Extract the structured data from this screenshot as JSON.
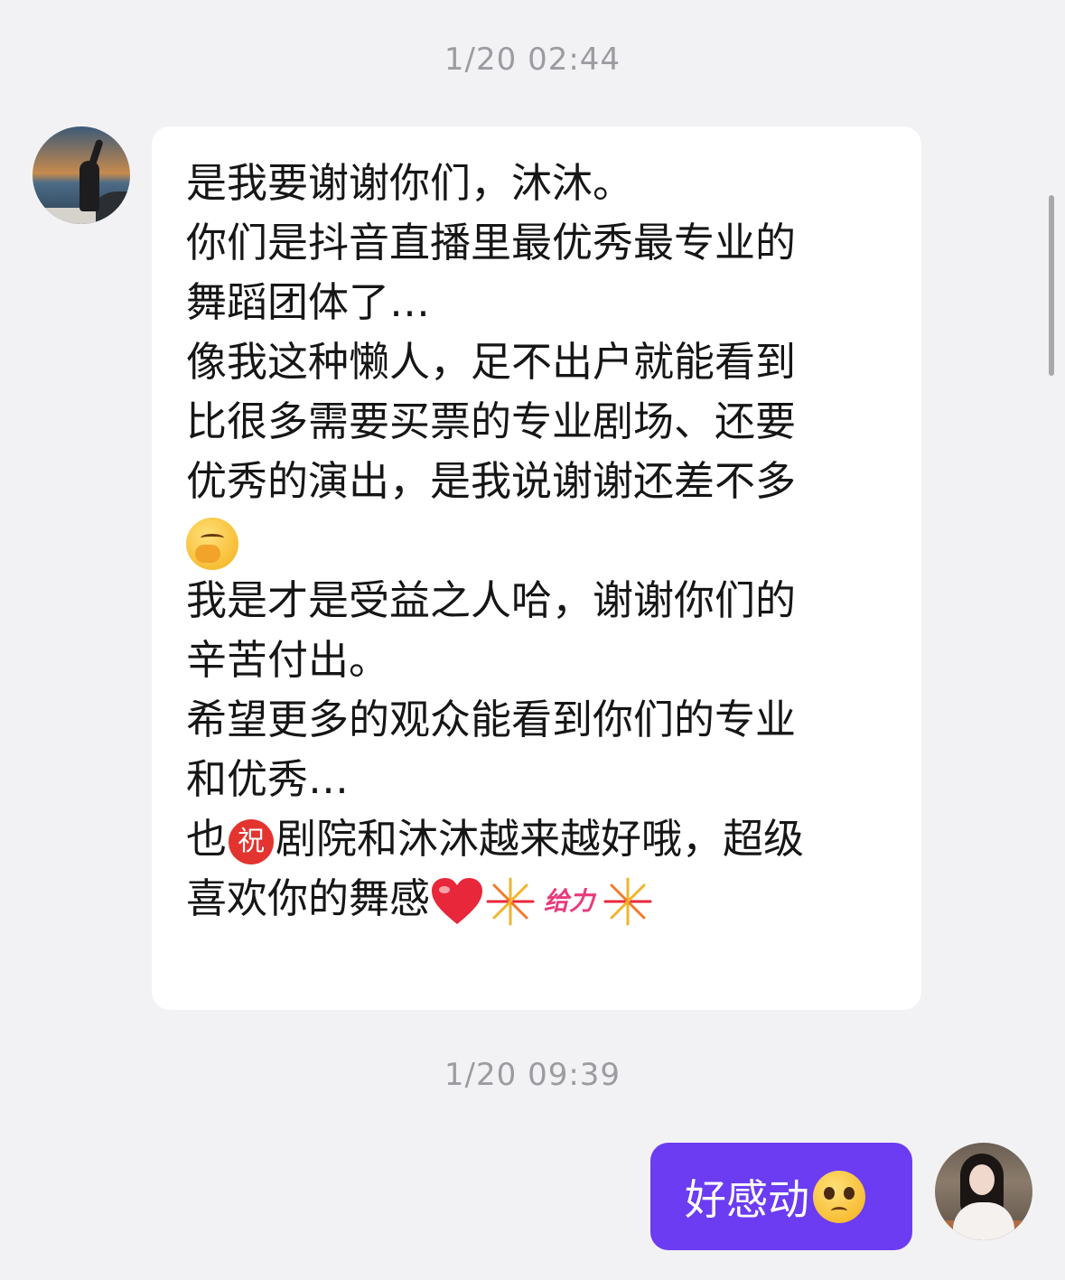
{
  "timestamps": {
    "first": "1/20 02:44",
    "second": "1/20 09:39"
  },
  "incoming_message": {
    "lines": {
      "l1": "是我要谢谢你们，沐沐。",
      "l2": "你们是抖音直播里最优秀最专业的",
      "l3": "舞蹈团体了…",
      "l4": "像我这种懒人，足不出户就能看到",
      "l5": "比很多需要买票的专业剧场、还要",
      "l6": "优秀的演出，是我说谢谢还差不多",
      "l8": "我是才是受益之人哈，谢谢你们的",
      "l9": "辛苦付出。",
      "l10": "希望更多的观众能看到你们的专业",
      "l11": "和优秀…",
      "l12a": "也",
      "l12b": "剧院和沐沐越来越好哦，超级",
      "l13": "喜欢你的舞感"
    },
    "emoji_zhu": "祝",
    "emoji_geili": "给力",
    "emojis": [
      "smiling-face-icon",
      "zhu-blessing-icon",
      "red-heart-icon",
      "firework-icon",
      "geili-icon",
      "firework-icon"
    ]
  },
  "outgoing_message": {
    "text": "好感动",
    "emoji": "pleading-face-icon"
  },
  "colors": {
    "background": "#f2f2f4",
    "incoming_bubble": "#ffffff",
    "outgoing_bubble": "#6b3cf2",
    "timestamp": "#9b9ba1"
  }
}
